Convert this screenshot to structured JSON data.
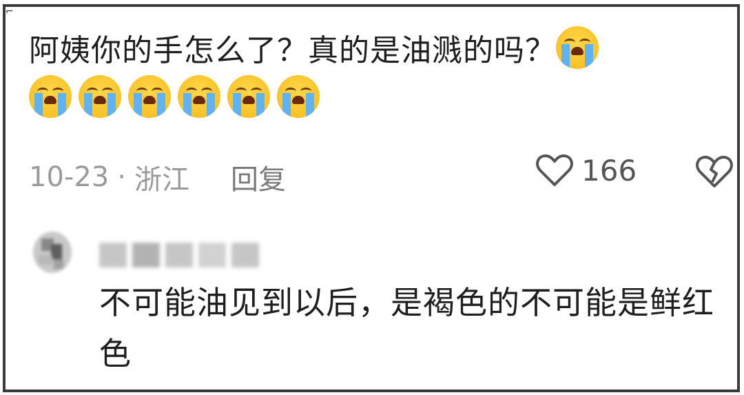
{
  "comment": {
    "text": "阿姨你的手怎么了？真的是油溅的吗？",
    "emoji_count": 7,
    "emoji_name": "loudly-crying-face",
    "date": "10-23",
    "location": "浙江",
    "separator": "·",
    "reply_label": "回复",
    "like_count": "166"
  },
  "reply": {
    "text": "不可能油见到以后，是褐色的不可能是鲜红色"
  },
  "colors": {
    "text": "#1e1e1e",
    "meta": "#9a9a9a",
    "emoji_face": "#f6b81a",
    "emoji_tear": "#5fb3f2",
    "frame_border": "#3a3a3a"
  }
}
